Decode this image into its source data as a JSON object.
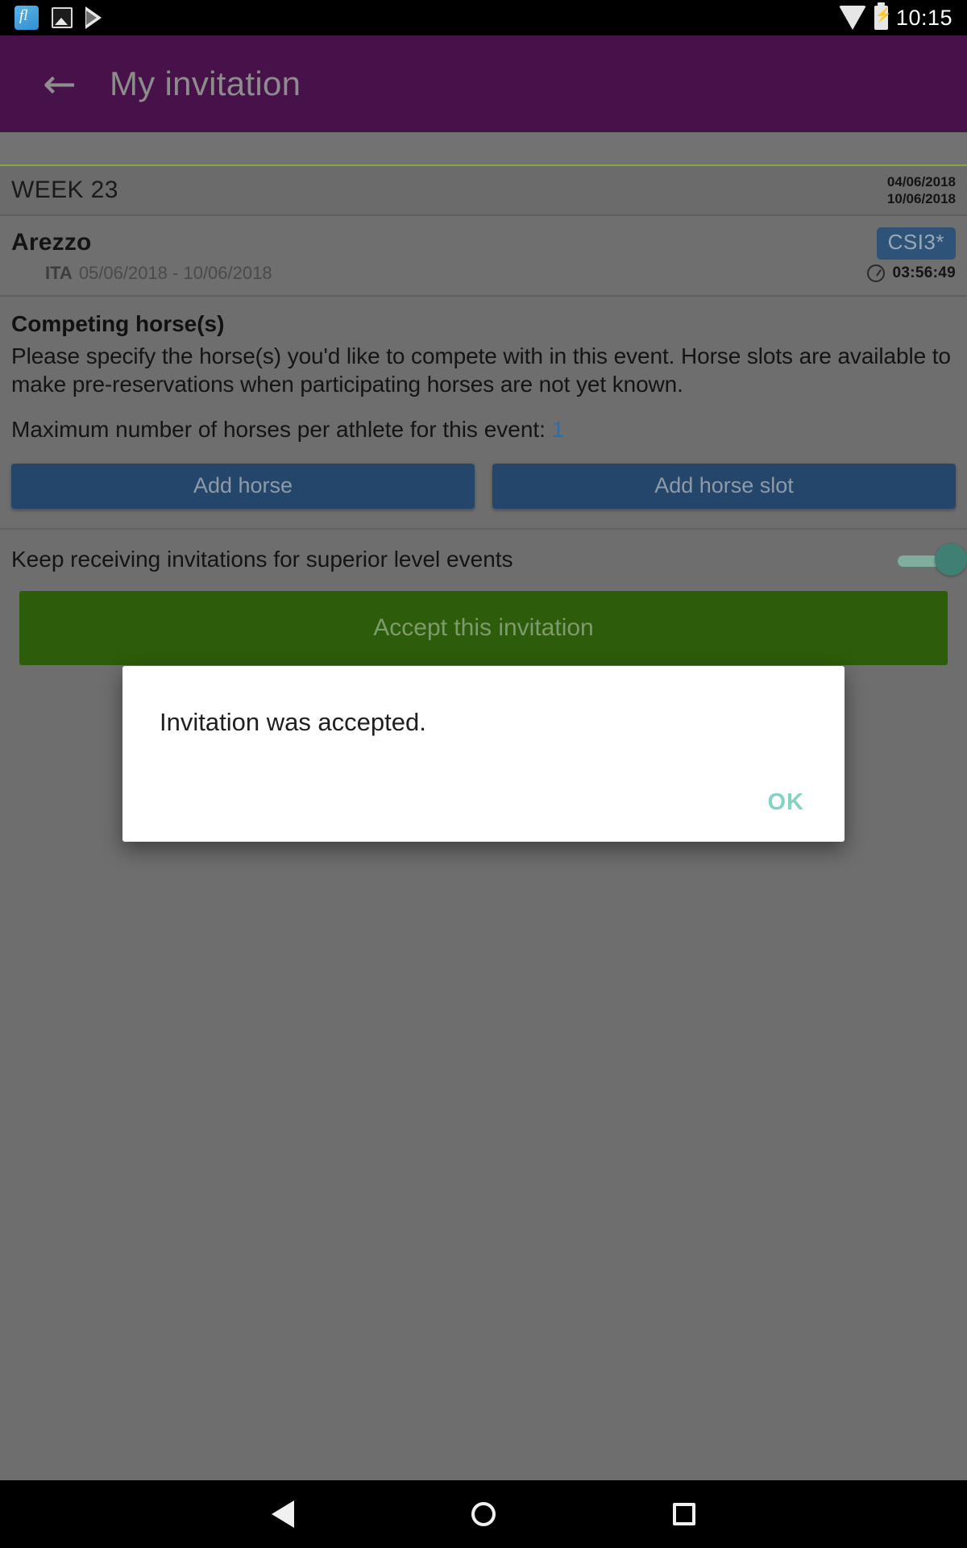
{
  "status_bar": {
    "time": "10:15",
    "icons": [
      "app-icon",
      "gallery-icon",
      "play-icon",
      "wifi-icon",
      "battery-charging-icon"
    ]
  },
  "app_bar": {
    "back_icon": "arrow-left-icon",
    "title": "My invitation"
  },
  "week": {
    "label": "WEEK 23",
    "date_start": "04/06/2018",
    "date_end": "10/06/2018"
  },
  "event": {
    "name": "Arezzo",
    "country": "ITA",
    "dates": "05/06/2018 - 10/06/2018",
    "level_badge": "CSI3*",
    "clock_icon": "clock-icon",
    "countdown": "03:56:49"
  },
  "horses": {
    "section_title": "Competing horse(s)",
    "description": "Please specify the horse(s) you'd like to compete with in this event. Horse slots are available to make pre-reservations when participating horses are not yet known.",
    "max_label": "Maximum number of horses per athlete for this event:",
    "max_value": "1",
    "add_horse_label": "Add horse",
    "add_horse_slot_label": "Add horse slot"
  },
  "toggle": {
    "label": "Keep receiving invitations for superior level events",
    "state": "on"
  },
  "accept": {
    "label": "Accept this invitation"
  },
  "dialog": {
    "message": "Invitation was accepted.",
    "ok_label": "OK"
  },
  "nav_bar": {
    "back": "nav-back-icon",
    "home": "nav-home-icon",
    "recents": "nav-recents-icon"
  },
  "colors": {
    "app_bar": "#47124a",
    "accent_green": "#86a83c",
    "badge_blue": "#2e5378",
    "button_blue": "#24466b",
    "accept_green": "#2d5c0a",
    "ok_teal": "#84d2c4",
    "scrim_grey": "#6e6e6e"
  }
}
